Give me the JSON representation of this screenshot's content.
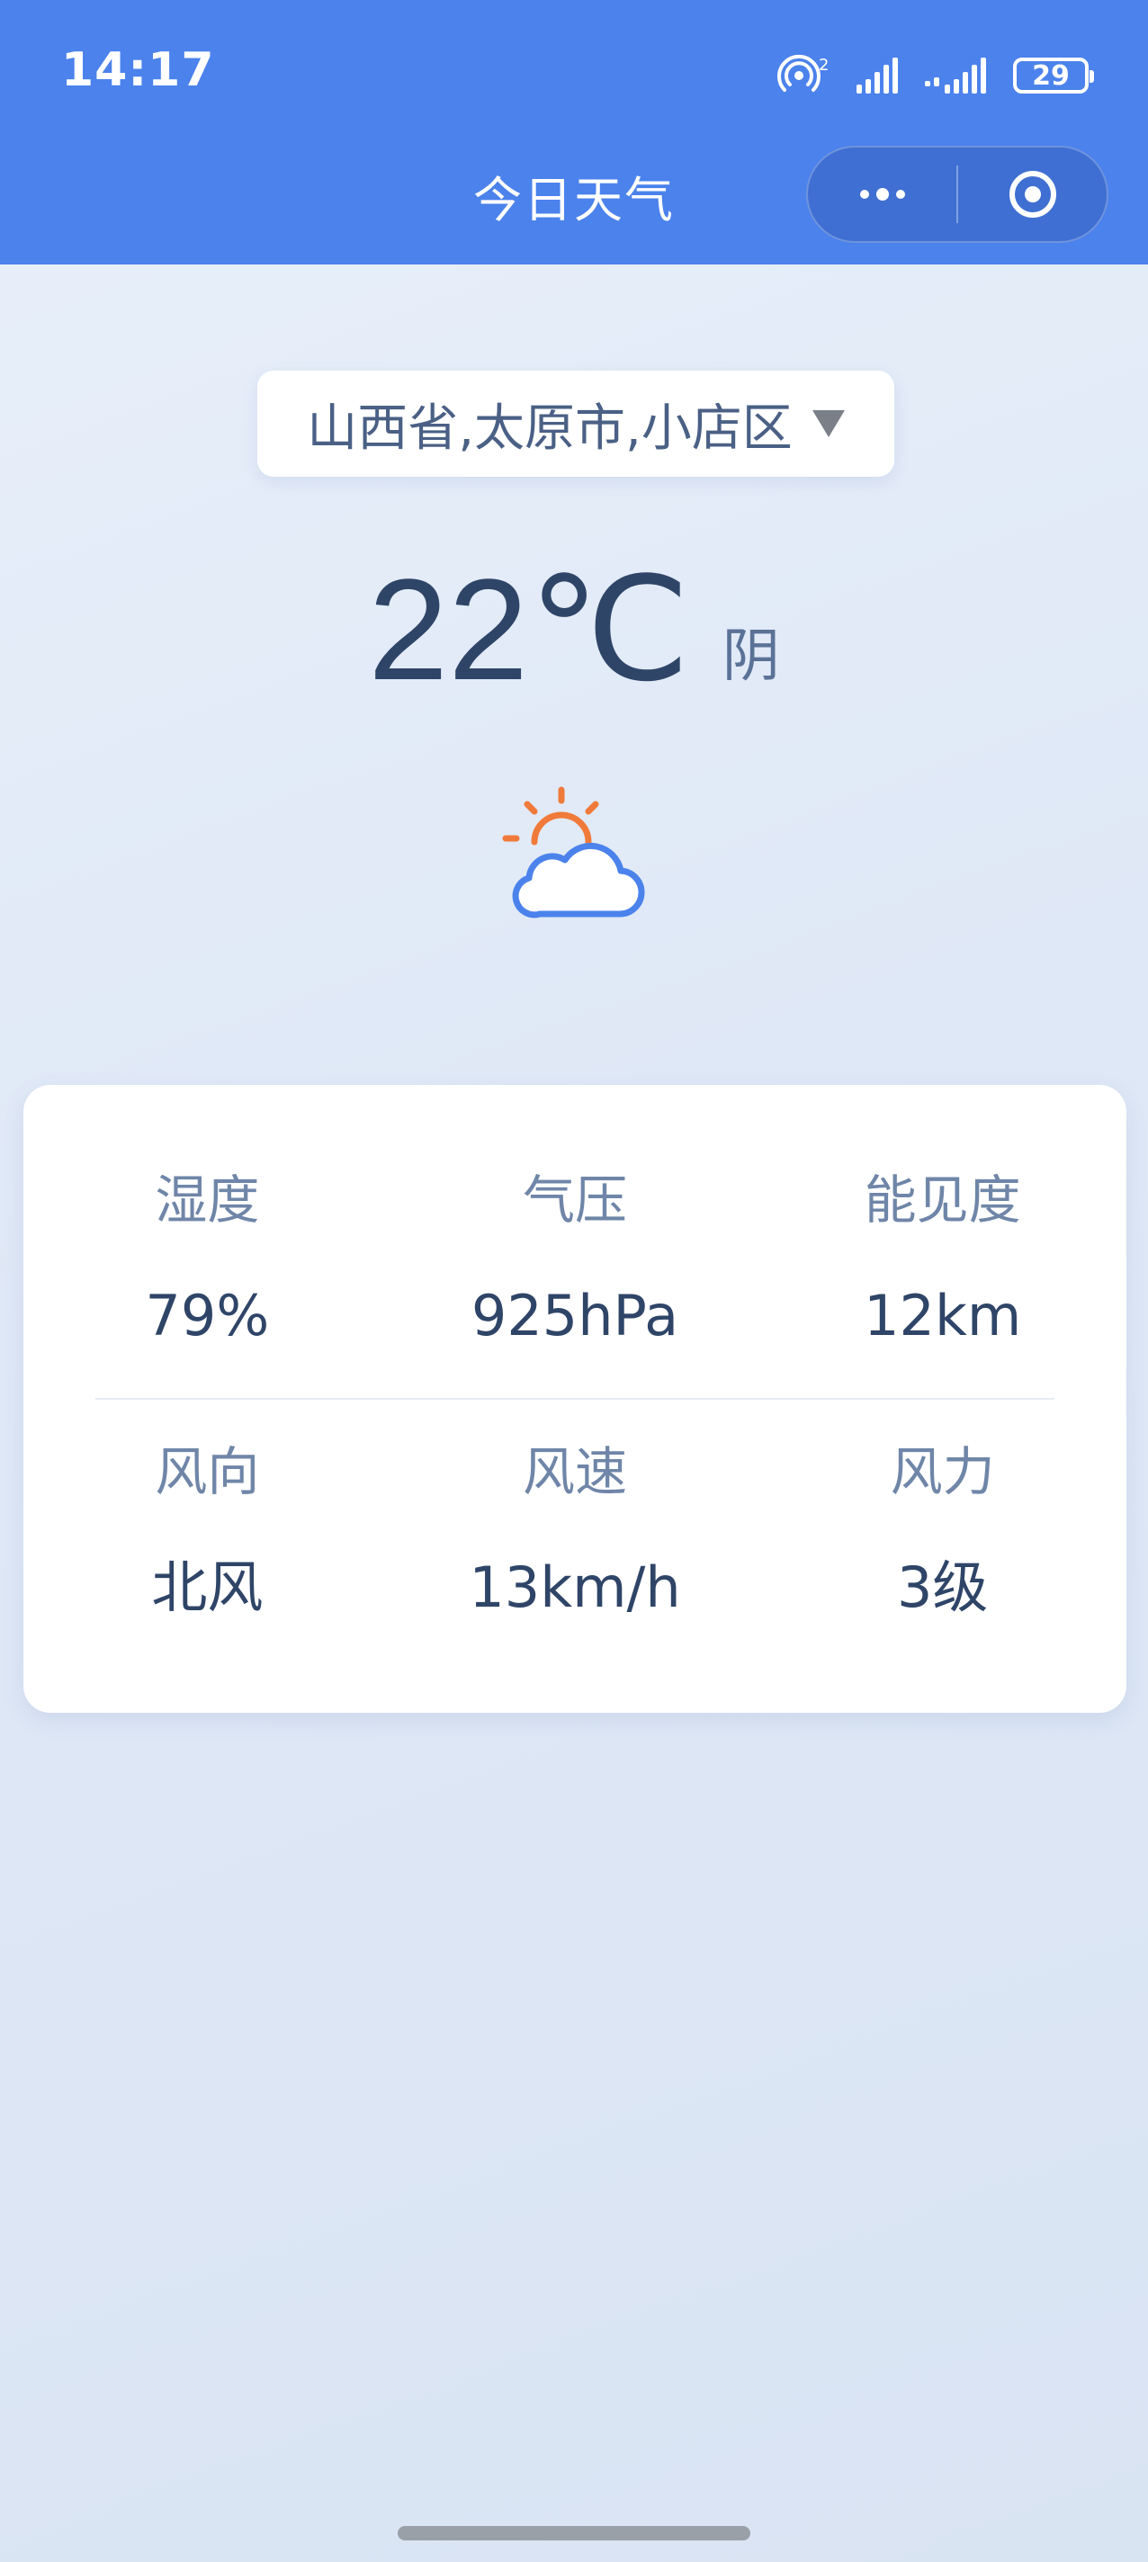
{
  "status_bar": {
    "time": "14:17",
    "hotspot_badge": "2",
    "battery": "29"
  },
  "header": {
    "title": "今日天气"
  },
  "location": {
    "text": "山西省,太原市,小店区"
  },
  "current": {
    "temperature": "22℃",
    "condition": "阴",
    "icon": "partly-cloudy-icon"
  },
  "details": [
    {
      "label": "湿度",
      "value": "79%"
    },
    {
      "label": "气压",
      "value": "925hPa"
    },
    {
      "label": "能见度",
      "value": "12km"
    },
    {
      "label": "风向",
      "value": "北风"
    },
    {
      "label": "风速",
      "value": "13km/h"
    },
    {
      "label": "风力",
      "value": "3级"
    }
  ],
  "colors": {
    "header": "#4b82ec",
    "sun": "#f07a3a",
    "cloud": "#4b82ec",
    "text_primary": "#2f4568",
    "text_secondary": "#6f86a8"
  }
}
